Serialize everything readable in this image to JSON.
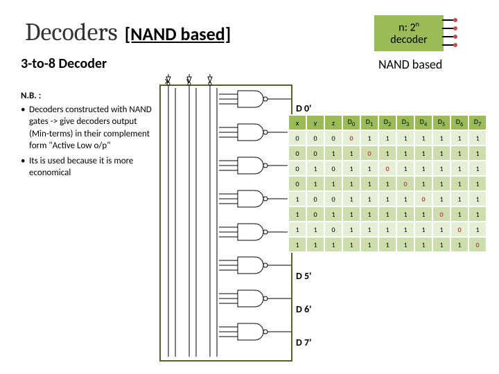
{
  "title": {
    "main": "Decoders",
    "sub": "[NAND based]"
  },
  "block": {
    "line1": "n: 2",
    "line2": "decoder"
  },
  "subtitle": "3-to-8 Decoder",
  "nand_label": "NAND based",
  "note": {
    "hdr": "N.B. :",
    "b1": "Decoders constructed with NAND gates -> give decoders output (Min-terms) in their complement form \"Active Low o/p\"",
    "b2": "Its is used because it is more economical"
  },
  "inputs": {
    "x": "x",
    "y": "y",
    "z": "z"
  },
  "outputs": [
    "D 0'",
    "D 5'",
    "D 6'",
    "D 7'"
  ],
  "chart_data": {
    "type": "table",
    "title": "3-to-8 NAND Decoder Truth Table",
    "columns": [
      "x",
      "y",
      "z",
      "D0",
      "D1",
      "D2",
      "D3",
      "D4",
      "D5",
      "D6",
      "D7"
    ],
    "rows": [
      [
        0,
        0,
        0,
        0,
        1,
        1,
        1,
        1,
        1,
        1,
        1
      ],
      [
        0,
        0,
        1,
        1,
        0,
        1,
        1,
        1,
        1,
        1,
        1
      ],
      [
        0,
        1,
        0,
        1,
        1,
        0,
        1,
        1,
        1,
        1,
        1
      ],
      [
        0,
        1,
        1,
        1,
        1,
        1,
        0,
        1,
        1,
        1,
        1
      ],
      [
        1,
        0,
        0,
        1,
        1,
        1,
        1,
        0,
        1,
        1,
        1
      ],
      [
        1,
        0,
        1,
        1,
        1,
        1,
        1,
        1,
        0,
        1,
        1
      ],
      [
        1,
        1,
        0,
        1,
        1,
        1,
        1,
        1,
        1,
        0,
        1
      ],
      [
        1,
        1,
        1,
        1,
        1,
        1,
        1,
        1,
        1,
        1,
        0
      ]
    ]
  }
}
